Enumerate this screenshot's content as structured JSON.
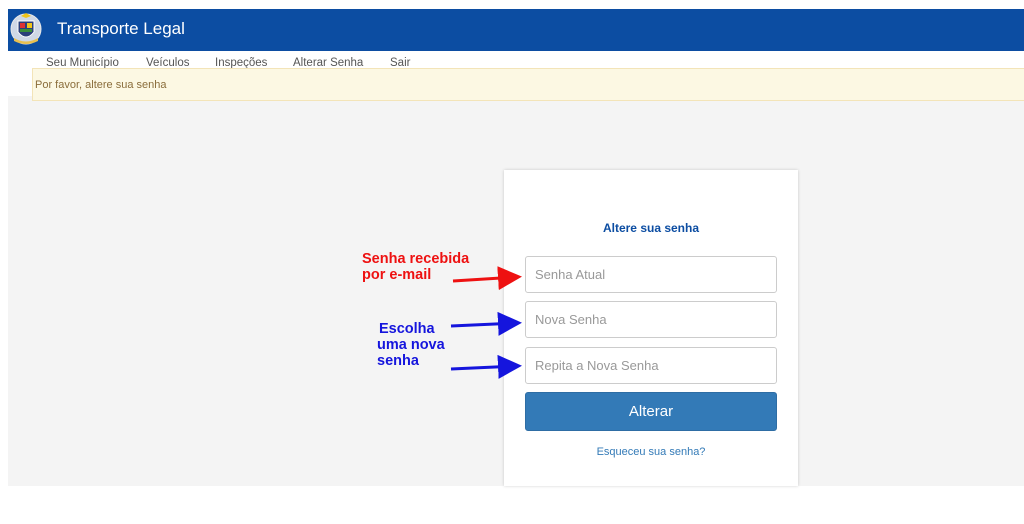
{
  "header": {
    "title": "Transporte Legal",
    "logo_icon": "crest-icon",
    "background": "#0c4da2"
  },
  "menu": {
    "items": [
      {
        "label": "Seu Município"
      },
      {
        "label": "Veículos"
      },
      {
        "label": "Inspeções"
      },
      {
        "label": "Alterar Senha"
      },
      {
        "label": "Sair"
      }
    ]
  },
  "alert": {
    "text": "Por favor, altere sua senha"
  },
  "form": {
    "title": "Altere sua senha",
    "current_password_placeholder": "Senha Atual",
    "new_password_placeholder": "Nova Senha",
    "repeat_password_placeholder": "Repita a Nova Senha",
    "submit_label": "Alterar",
    "forgot_link": "Esqueceu sua senha?",
    "button_color": "#337ab7"
  },
  "annotations": {
    "red_line1": "Senha recebida",
    "red_line2": "por e-mail",
    "blue_line1": "Escolha",
    "blue_line2": "uma nova",
    "blue_line3": "senha",
    "red_color": "#ee1111",
    "blue_color": "#1515dd"
  }
}
